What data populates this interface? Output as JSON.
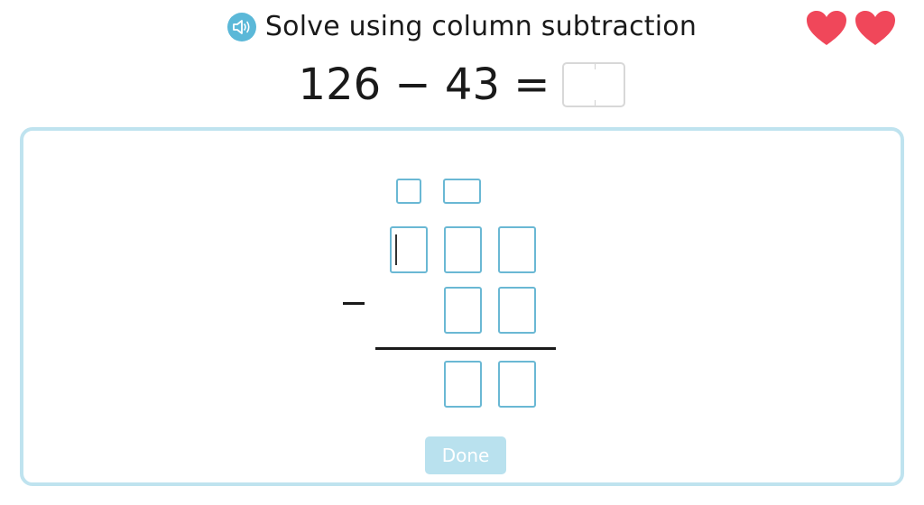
{
  "instruction": {
    "speaker_icon": "speaker-icon",
    "text": "Solve using column subtraction"
  },
  "lives": {
    "icon": "heart-icon",
    "count": 2,
    "color": "#f0475a"
  },
  "equation": {
    "text": "126 − 43 =",
    "answer_value": ""
  },
  "workspace": {
    "border_color": "#bfe3ef",
    "cell_border_color": "#6ab8d4",
    "borrow_row": [
      "",
      ""
    ],
    "top_number": [
      "",
      "",
      ""
    ],
    "bottom_number": [
      "",
      ""
    ],
    "operator": "minus",
    "result": [
      "",
      ""
    ]
  },
  "done_button": {
    "label": "Done",
    "color": "#b9e1ee"
  }
}
